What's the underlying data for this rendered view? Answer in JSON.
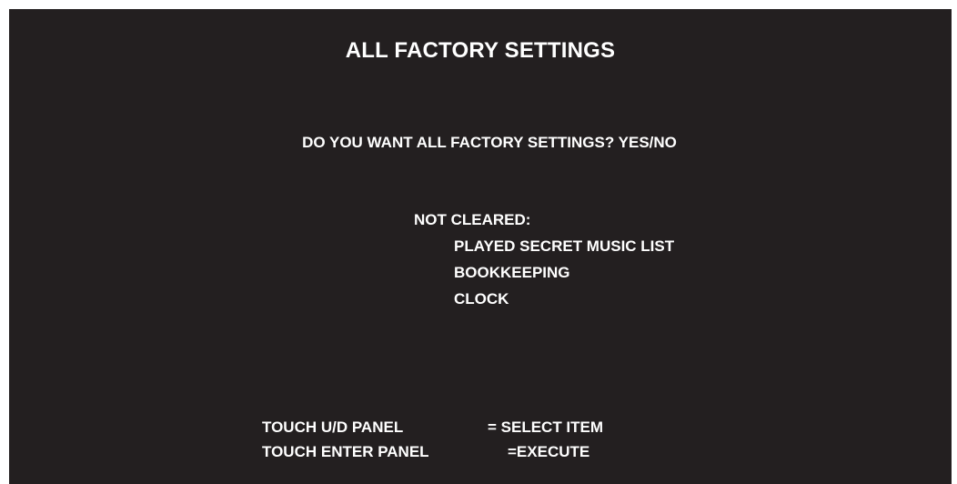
{
  "screen": {
    "title": "ALL FACTORY SETTINGS",
    "question": "DO YOU WANT ALL FACTORY SETTINGS? YES/NO",
    "not_cleared": {
      "label": "NOT CLEARED:",
      "items": [
        "PLAYED SECRET MUSIC LIST",
        "BOOKKEEPING",
        "CLOCK"
      ]
    },
    "controls": [
      {
        "key": "TOUCH U/D PANEL",
        "action": "= SELECT ITEM"
      },
      {
        "key": "TOUCH ENTER PANEL",
        "action": "=EXECUTE"
      }
    ]
  },
  "colors": {
    "background": "#231f20",
    "text": "#ffffff",
    "border": "#ffffff"
  }
}
